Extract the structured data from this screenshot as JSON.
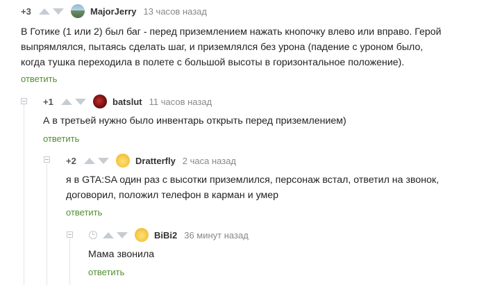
{
  "comments": [
    {
      "rating": "+3",
      "username": "MajorJerry",
      "time": "13 часов назад",
      "lines": [
        "В Готике (1 или 2) был баг - перед приземлением нажать кнопочку влево или вправо. Герой",
        "выпрямлялся, пытаясь сделать шаг, и приземлялся без урона (падение с уроном было,",
        "когда тушка переходила в полете с большой высоты в горизонтальное положение)."
      ],
      "reply": "ответить"
    },
    {
      "rating": "+1",
      "username": "batslut",
      "time": "11 часов назад",
      "lines": [
        "А в третьей нужно было инвентарь открыть перед приземлением)"
      ],
      "reply": "ответить"
    },
    {
      "rating": "+2",
      "username": "Dratterfly",
      "time": "2 часа назад",
      "lines": [
        "я в GTA:SA один раз с высотки приземлился, персонаж встал, ответил на звонок,",
        "договорил, положил телефон в карман и умер"
      ],
      "reply": "ответить"
    },
    {
      "rating": "",
      "username": "BiBi2",
      "time": "36 минут назад",
      "lines": [
        "Мама звонила"
      ],
      "reply": "ответить"
    }
  ],
  "icons": {
    "avatar_majorjerry": "avatar-landscape-icon",
    "avatar_batslut": "avatar-red-blob-icon",
    "avatar_dratterfly": "avatar-yellow-face-icon",
    "avatar_bibi2": "avatar-yellow-face-icon",
    "pending_rating": "clock-icon"
  },
  "colors": {
    "reply_link": "#4f8f2f",
    "vote_arrow": "#c6ccd2",
    "meta_text": "#888888"
  }
}
